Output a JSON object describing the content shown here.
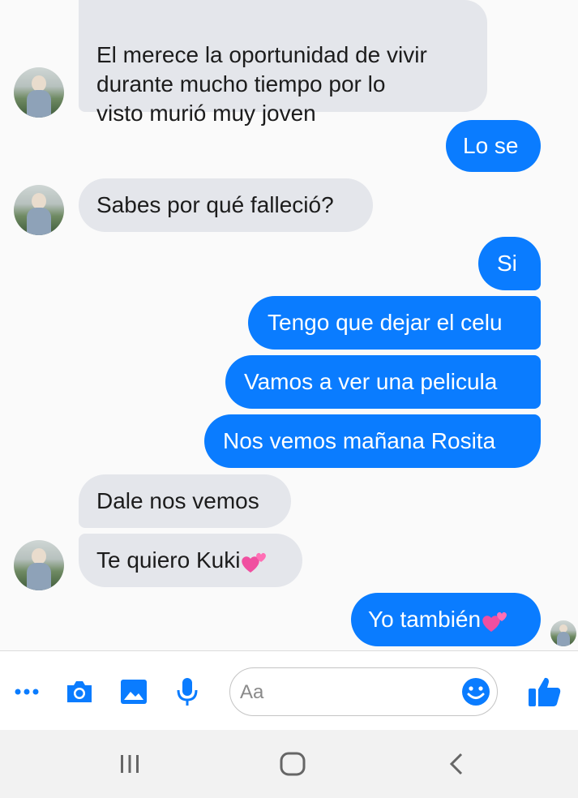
{
  "messages": [
    {
      "side": "in",
      "text": "El merece la oportunidad de vivir\ndurante mucho tiempo por lo\nvisto murió muy joven"
    },
    {
      "side": "out",
      "text": "Lo se"
    },
    {
      "side": "in",
      "text": "Sabes por qué falleció?"
    },
    {
      "side": "out",
      "text": "Si"
    },
    {
      "side": "out",
      "text": "Tengo que dejar el celu"
    },
    {
      "side": "out",
      "text": "Vamos a ver una pelicula"
    },
    {
      "side": "out",
      "text": "Nos vemos mañana Rosita"
    },
    {
      "side": "in",
      "text": "Dale nos vemos"
    },
    {
      "side": "in",
      "text": "Te quiero Kuki",
      "emoji": "two-hearts"
    },
    {
      "side": "out",
      "text": "Yo también",
      "emoji": "two-hearts"
    }
  ],
  "composer": {
    "placeholder": "Aa",
    "icons": [
      "more-icon",
      "camera-icon",
      "gallery-icon",
      "microphone-icon",
      "emoji-icon",
      "like-icon"
    ],
    "accent": "#0a7cff"
  },
  "navbar": {
    "icons": [
      "recent-apps-icon",
      "home-icon",
      "back-icon"
    ]
  },
  "colors": {
    "incoming": "#e4e6eb",
    "outgoing": "#0a7cff",
    "background": "#fafafa"
  }
}
